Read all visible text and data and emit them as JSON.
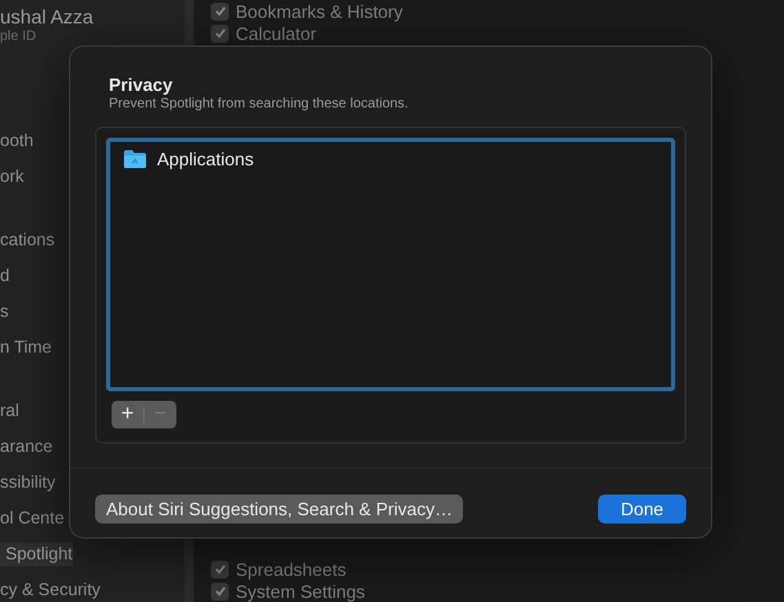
{
  "sidebar": {
    "account": {
      "name": "ushal Azza",
      "subtitle": "ple ID"
    },
    "groups": [
      [
        {
          "label": "ooth",
          "selected": false
        },
        {
          "label": "ork",
          "selected": false
        }
      ],
      [
        {
          "label": "cations",
          "selected": false
        },
        {
          "label": "d",
          "selected": false
        },
        {
          "label": "s",
          "selected": false
        },
        {
          "label": "n Time",
          "selected": false
        }
      ],
      [
        {
          "label": "ral",
          "selected": false
        },
        {
          "label": "arance",
          "selected": false
        },
        {
          "label": "ssibility",
          "selected": false
        },
        {
          "label": "ol Cente",
          "selected": false
        },
        {
          "label": "Spotlight",
          "selected": true
        },
        {
          "label": "cy & Security",
          "selected": false
        }
      ]
    ]
  },
  "categories_top": [
    {
      "label": "Bookmarks & History",
      "checked": true
    },
    {
      "label": "Calculator",
      "checked": true
    }
  ],
  "categories_bottom": [
    {
      "label": "Spreadsheets",
      "checked": true
    },
    {
      "label": "System Settings",
      "checked": true
    }
  ],
  "dialog": {
    "title": "Privacy",
    "subtitle": "Prevent Spotlight from searching these locations.",
    "locations": [
      {
        "label": "Applications",
        "selected": false
      }
    ],
    "list_buttons": [
      {
        "label": "+",
        "disabled": false
      },
      {
        "label": "−",
        "disabled": true
      }
    ],
    "about_button": "About Siri Suggestions, Search & Privacy…",
    "done_button": "Done"
  }
}
